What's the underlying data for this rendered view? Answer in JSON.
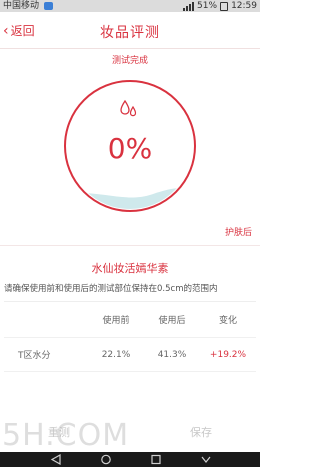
{
  "status_bar": {
    "carrier": "中国移动",
    "battery": "51%",
    "time": "12:59"
  },
  "header": {
    "back_label": "返回",
    "title": "妆品评测"
  },
  "test": {
    "status": "测试完成",
    "percent_text": "0%",
    "fill_level": 0.13,
    "skin_label": "护肤后"
  },
  "product": {
    "name": "水仙妆活嫣华素",
    "note": "请确保使用前和使用后的测试部位保持在0.5cm的范围内"
  },
  "table": {
    "headers": [
      "",
      "使用前",
      "使用后",
      "变化"
    ],
    "rows": [
      {
        "label": "T区水分",
        "before": "22.1%",
        "after": "41.3%",
        "change": "+19.2%"
      }
    ]
  },
  "actions": {
    "retest": "重测",
    "save": "保存"
  },
  "watermark": "5H.COM",
  "colors": {
    "accent": "#d9323f",
    "water": "#cfe9ec"
  }
}
